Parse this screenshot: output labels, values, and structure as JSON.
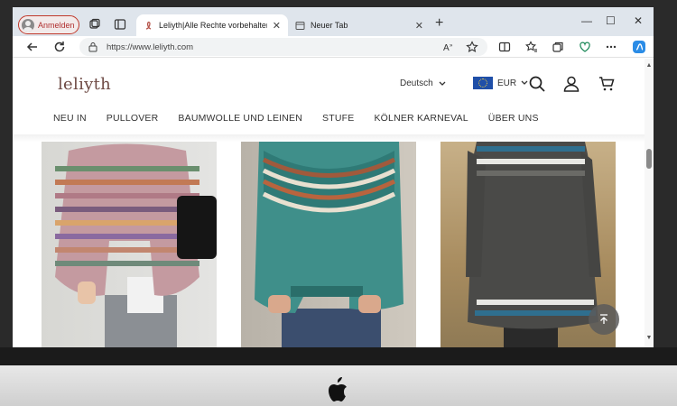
{
  "browser": {
    "profile_label": "Anmelden",
    "tabs": [
      {
        "title": "Leliyth|Alle Rechte vorbehalten.",
        "active": true
      },
      {
        "title": "Neuer Tab",
        "active": false
      }
    ],
    "url": "https://www.leliyth.com",
    "icons": {
      "back": "back-arrow-icon",
      "reload": "reload-icon",
      "lock": "lock-icon",
      "read_aloud": "read-aloud-icon",
      "favorite": "star-icon",
      "split": "split-screen-icon",
      "favorites_bar": "favorites-icon",
      "collections": "collections-icon",
      "extensions": "heart-shield-icon",
      "menu": "more-icon",
      "copilot": "copilot-icon"
    }
  },
  "site": {
    "brand": "leliyth",
    "language": "Deutsch",
    "currency": "EUR",
    "menu": [
      "NEU IN",
      "PULLOVER",
      "BAUMWOLLE UND LEINEN",
      "STUFE",
      "KÖLNER KARNEVAL",
      "ÜBER UNS"
    ],
    "products": [
      {
        "name": "product-striped-fair-isle-sweater",
        "main_color": "#b07a86"
      },
      {
        "name": "product-teal-fair-isle-sweater",
        "main_color": "#3f8f8a"
      },
      {
        "name": "product-charcoal-fair-isle-sweater",
        "main_color": "#4a4a48"
      }
    ]
  },
  "colors": {
    "brand": "#6e4a44",
    "profile_border": "#c0392b",
    "tabbar_bg": "#dfe5ec"
  }
}
